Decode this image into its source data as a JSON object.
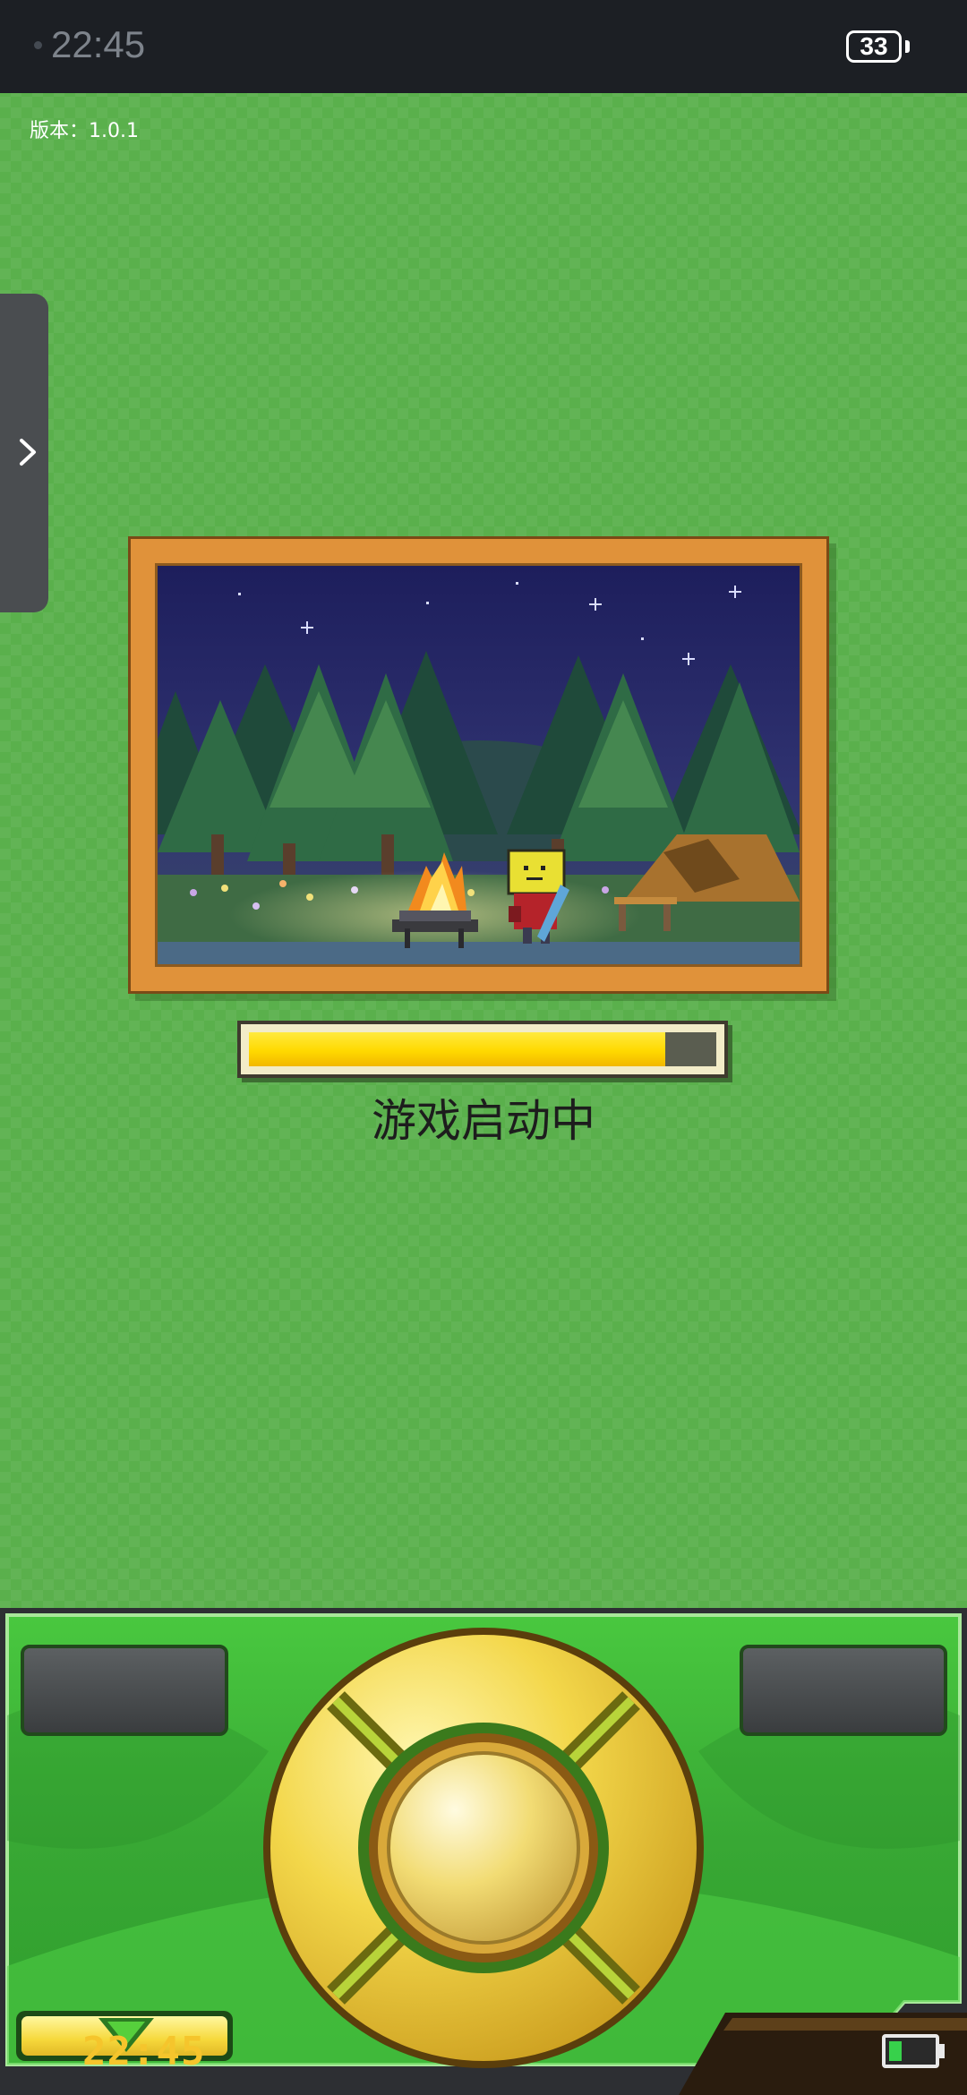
{
  "status_bar": {
    "time": "22:45",
    "battery": "33"
  },
  "version_text": "版本：1.0.1",
  "side_panel": {
    "icon": "chevron-right-icon"
  },
  "scene": {
    "description_icon": "campfire-night-scene"
  },
  "loading": {
    "progress_percent": 89,
    "text": "游戏启动中"
  },
  "controller": {
    "clock": "22:45",
    "battery_percent": 33,
    "colors": {
      "panel_green": "#3fbf3a",
      "gold": "#f4d94a",
      "loading_yellow": "#ffd900"
    }
  }
}
